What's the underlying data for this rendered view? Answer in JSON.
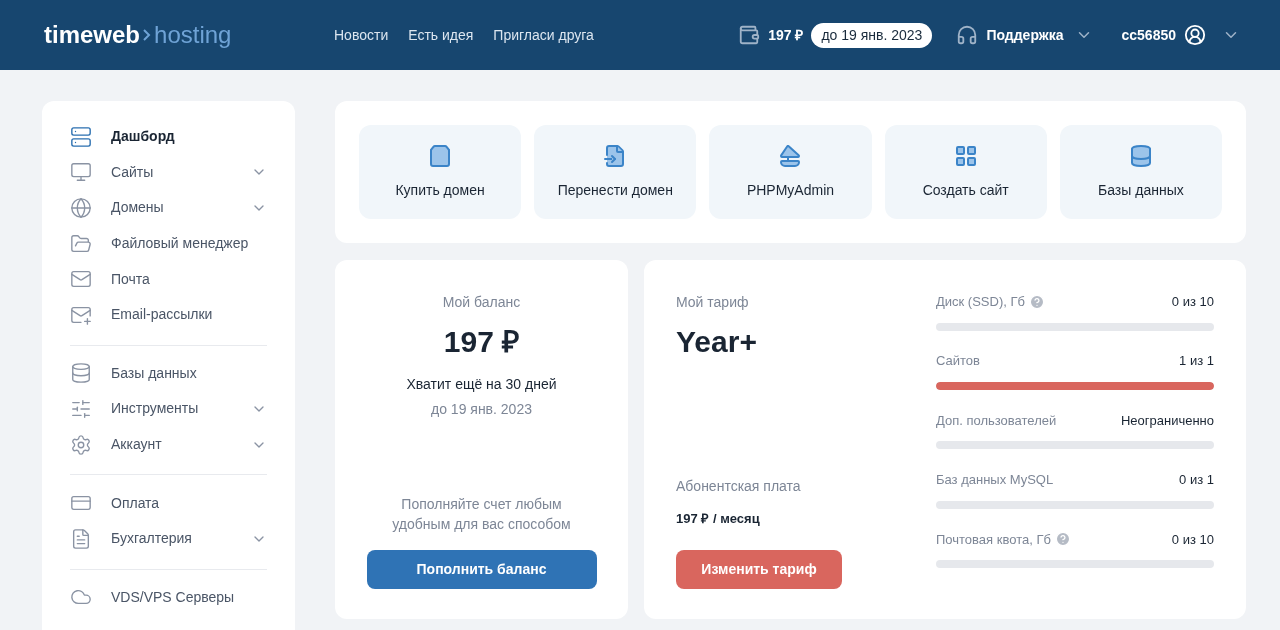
{
  "header": {
    "logo": {
      "brand": "timeweb",
      "product": "hosting"
    },
    "nav": [
      "Новости",
      "Есть идея",
      "Пригласи друга"
    ],
    "balance": "197 ₽",
    "balance_until": "до 19 янв. 2023",
    "support": "Поддержка",
    "user": "cc56850"
  },
  "sidebar": {
    "groups": [
      [
        {
          "label": "Дашборд",
          "selected": true,
          "expandable": false
        },
        {
          "label": "Сайты",
          "selected": false,
          "expandable": true
        },
        {
          "label": "Домены",
          "selected": false,
          "expandable": true
        },
        {
          "label": "Файловый менеджер",
          "selected": false,
          "expandable": false
        },
        {
          "label": "Почта",
          "selected": false,
          "expandable": false
        },
        {
          "label": "Email-рассылки",
          "selected": false,
          "expandable": false
        }
      ],
      [
        {
          "label": "Базы данных",
          "selected": false,
          "expandable": false
        },
        {
          "label": "Инструменты",
          "selected": false,
          "expandable": true
        },
        {
          "label": "Аккаунт",
          "selected": false,
          "expandable": true
        }
      ],
      [
        {
          "label": "Оплата",
          "selected": false,
          "expandable": false
        },
        {
          "label": "Бухгалтерия",
          "selected": false,
          "expandable": true
        }
      ],
      [
        {
          "label": "VDS/VPS Серверы",
          "selected": false,
          "expandable": false
        }
      ]
    ]
  },
  "quick_actions": [
    "Купить домен",
    "Перенести домен",
    "PHPMyAdmin",
    "Создать сайт",
    "Базы данных"
  ],
  "balance_card": {
    "title": "Мой баланс",
    "amount": "197 ₽",
    "days_left": "Хватит ещё на 30 дней",
    "until": "до 19 янв. 2023",
    "hint": "Пополняйте счет любым удобным для вас способом",
    "button": "Пополнить баланс"
  },
  "tariff_card": {
    "title": "Мой тариф",
    "name": "Year+",
    "fee_label": "Абонентская плата",
    "fee": "197 ₽ / месяц",
    "button": "Изменить тариф",
    "quotas": [
      {
        "label": "Диск (SSD), Гб",
        "help": true,
        "reading": "0 из 10",
        "level": 0
      },
      {
        "label": "Сайтов",
        "help": false,
        "reading": "1 из 1",
        "level": 1
      },
      {
        "label": "Доп. пользователей",
        "help": false,
        "reading": "Неограниченно",
        "level": 0
      },
      {
        "label": "Баз данных MySQL",
        "help": false,
        "reading": "0 из 1",
        "level": 0
      },
      {
        "label": "Почтовая квота, Гб",
        "help": true,
        "reading": "0 из 10",
        "level": 0
      }
    ]
  }
}
